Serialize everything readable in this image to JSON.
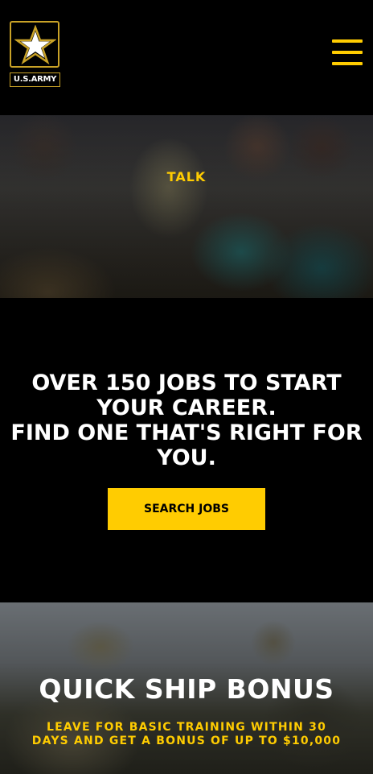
{
  "header": {
    "logo_text": "U.S.ARMY",
    "logo_icon": "army-star-icon",
    "menu_icon": "hamburger-menu-icon"
  },
  "hero": {
    "label": "TALK"
  },
  "jobs": {
    "heading_lines": [
      "OVER 150 JOBS TO START",
      "YOUR CAREER.",
      "FIND ONE THAT'S RIGHT FOR",
      "YOU."
    ],
    "button_label": "SEARCH JOBS"
  },
  "bonus": {
    "title": "QUICK SHIP BONUS",
    "text": "LEAVE FOR BASIC TRAINING WITHIN 30 DAYS AND GET A BONUS OF UP TO $10,000"
  },
  "colors": {
    "accent": "#ffcc01",
    "logo_border": "#c9a227",
    "background": "#000000"
  }
}
